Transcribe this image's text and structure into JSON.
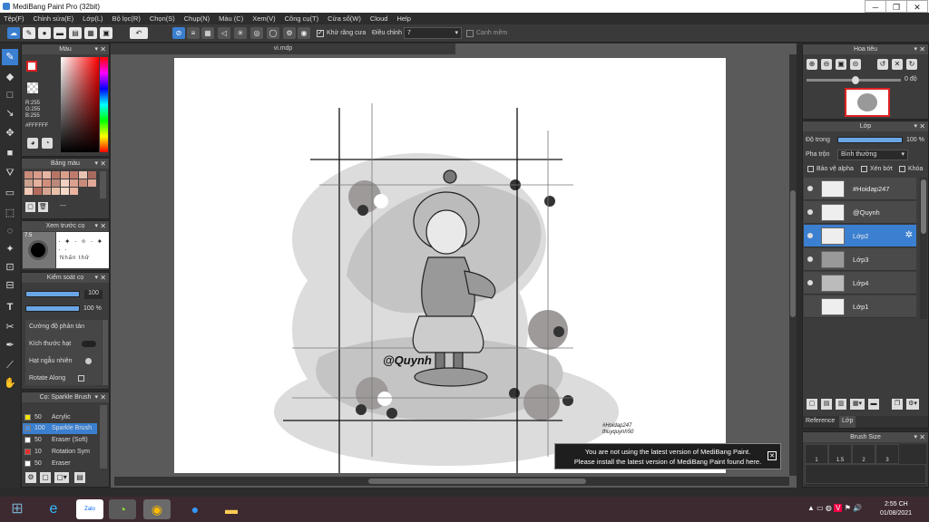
{
  "window": {
    "title": "MediBang Paint Pro (32bit)"
  },
  "menu": [
    "Tệp(F)",
    "Chỉnh sửa(E)",
    "Lớp(L)",
    "Bộ lọc(R)",
    "Chọn(S)",
    "Chụp(N)",
    "Màu (C)",
    "Xem(V)",
    "Công cụ(T)",
    "Cửa sổ(W)",
    "Cloud",
    "Help"
  ],
  "toolbar": {
    "antialias_label": "Khử răng cưa",
    "correction_label": "Điều chỉnh",
    "correction_value": "7",
    "snap_label": "Cạnh mềm"
  },
  "color_panel": {
    "title": "Màu",
    "r": "R:255",
    "g": "G:255",
    "b": "B:255",
    "hex": "#FFFFFF"
  },
  "palette_panel": {
    "title": "Bảng màu",
    "more": "---"
  },
  "preview_panel": {
    "title": "Xem trước cọ",
    "size_label": "7.5",
    "sample_text": "Nhấn thử"
  },
  "brush_control": {
    "title": "Kiểm soát cọ",
    "size_value": "100",
    "opacity_value": "100 %",
    "options": [
      "Cường độ phản tán",
      "Kích thước hạt",
      "Hạt ngẫu nhiên",
      "Rotate Along"
    ]
  },
  "brush_list": {
    "title": "Cọ: Sparkle Brush",
    "items": [
      {
        "size": "50",
        "name": "Acrylic",
        "color": "#f2e200"
      },
      {
        "size": "100",
        "name": "Sparkle Brush",
        "color": "#4b8fe0",
        "selected": true
      },
      {
        "size": "50",
        "name": "Eraser (Soft)",
        "color": "#ffffff"
      },
      {
        "size": "10",
        "name": "Rotation Sym",
        "color": "#e03030"
      },
      {
        "size": "50",
        "name": "Eraser",
        "color": "#ffffff"
      }
    ]
  },
  "document": {
    "tab": "vi.mdp",
    "signature": "@Quynh",
    "watermark_1": "#Hoidap247",
    "watermark_2": "thuyquynh50"
  },
  "navigator": {
    "title": "Hoa tiêu",
    "angle": "0 độ"
  },
  "layer_panel": {
    "title": "Lớp",
    "opacity_label": "Độ trong",
    "opacity_value": "100 %",
    "blend_label": "Pha trộn",
    "blend_value": "Bình thường",
    "protect_alpha": "Bảo vệ alpha",
    "clipping": "Xén bớt",
    "lock": "Khóa",
    "layers": [
      {
        "name": "#Hoidap247",
        "selected": false
      },
      {
        "name": "@Quynh",
        "selected": false
      },
      {
        "name": "Lớp2",
        "selected": true
      },
      {
        "name": "Lớp3",
        "selected": false
      },
      {
        "name": "Lớp4",
        "selected": false
      },
      {
        "name": "Lớp1",
        "selected": false
      }
    ],
    "tabs": [
      "Reference",
      "Lớp"
    ]
  },
  "brush_size_panel": {
    "title": "Brush Size",
    "values": [
      "1",
      "1.5",
      "2",
      "3"
    ]
  },
  "notification": {
    "line1": "You are not using the latest version of MediBang Paint.",
    "line2": "Please install the latest version of MediBang Paint found here."
  },
  "taskbar": {
    "time": "2:55 CH",
    "date": "01/08/2021",
    "zalo": "Zalo"
  },
  "colors": {
    "accent": "#3b7fd0",
    "panel": "#3c3c3c",
    "taskbar": "#3d2a30"
  }
}
